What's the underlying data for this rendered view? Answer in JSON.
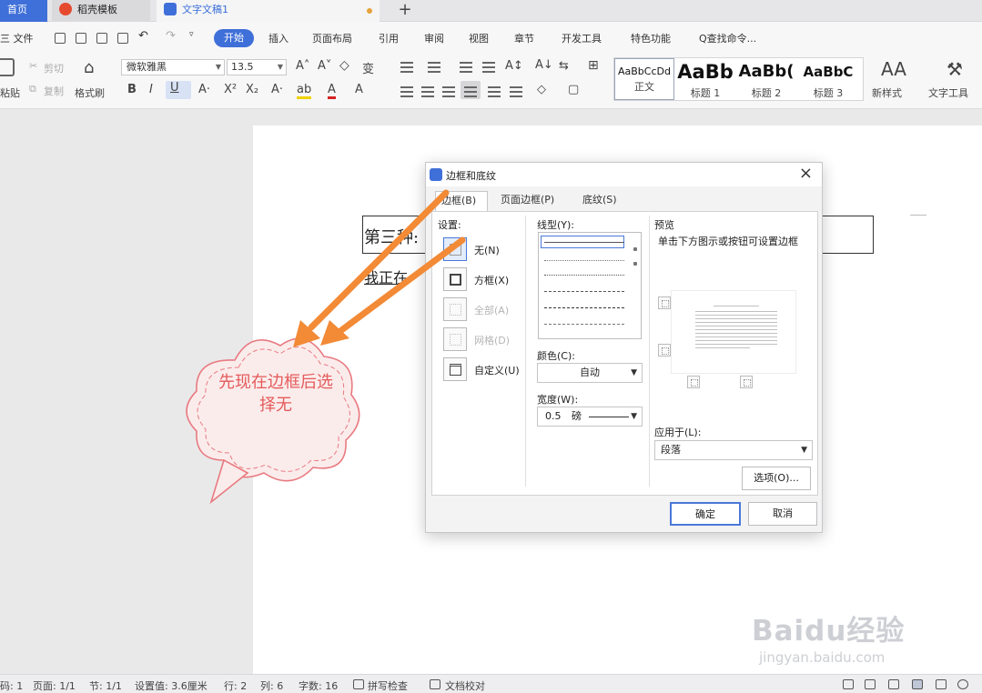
{
  "tabs": {
    "home": "首页",
    "templates": "稻壳模板",
    "document": "文字文稿1",
    "new_tab": "+"
  },
  "menu": {
    "file": "三 文件",
    "start": "开始",
    "insert": "插入",
    "layout": "页面布局",
    "references": "引用",
    "review": "审阅",
    "view": "视图",
    "section": "章节",
    "developer": "开发工具",
    "special": "特色功能",
    "search": "Q查找命令..."
  },
  "ribbon": {
    "paste": "粘贴",
    "cut": "剪切",
    "copy": "复制",
    "format_painter": "格式刷",
    "font_name": "微软雅黑",
    "font_size": "13.5",
    "bold": "B",
    "italic": "I",
    "underline": "U",
    "styles": [
      {
        "sample": "AaBbCcDd",
        "name": "正文"
      },
      {
        "sample": "AaBb",
        "name": "标题 1"
      },
      {
        "sample": "AaBb(",
        "name": "标题 2"
      },
      {
        "sample": "AaBbC",
        "name": "标题 3"
      }
    ],
    "new_style": "新样式",
    "text_tools": "文字工具"
  },
  "document": {
    "line1": "第三种:",
    "line2": "我正在"
  },
  "dialog": {
    "title": "边框和底纹",
    "close": "×",
    "tabs": [
      "边框(B)",
      "页面边框(P)",
      "底纹(S)"
    ],
    "settings_label": "设置:",
    "settings": [
      {
        "label": "无(N)",
        "enabled": true
      },
      {
        "label": "方框(X)",
        "enabled": true
      },
      {
        "label": "全部(A)",
        "enabled": false
      },
      {
        "label": "网格(D)",
        "enabled": false
      },
      {
        "label": "自定义(U)",
        "enabled": true
      }
    ],
    "line_style_label": "线型(Y):",
    "color_label": "颜色(C):",
    "color_value": "自动",
    "width_label": "宽度(W):",
    "width_value": "0.5",
    "width_unit": "磅",
    "preview_label": "预览",
    "preview_hint": "单击下方图示或按钮可设置边框",
    "apply_to_label": "应用于(L):",
    "apply_to_value": "段落",
    "options_button": "选项(O)...",
    "ok_button": "确定",
    "cancel_button": "取消"
  },
  "annotation": {
    "text": "先现在边框后选择无",
    "color": "#e45a5a",
    "arrow_color": "#f28a36"
  },
  "statusbar": {
    "page_num": "码: 1",
    "page": "页面: 1/1",
    "section": "节: 1/1",
    "setting": "设置值: 3.6厘米",
    "row": "行: 2",
    "col": "列: 6",
    "words": "字数: 16",
    "spellcheck": "拼写检查",
    "proofread": "文档校对"
  },
  "watermark": {
    "brand": "Baidu经验",
    "url": "jingyan.baidu.com"
  },
  "colors": {
    "accent": "#3f6fd8"
  }
}
